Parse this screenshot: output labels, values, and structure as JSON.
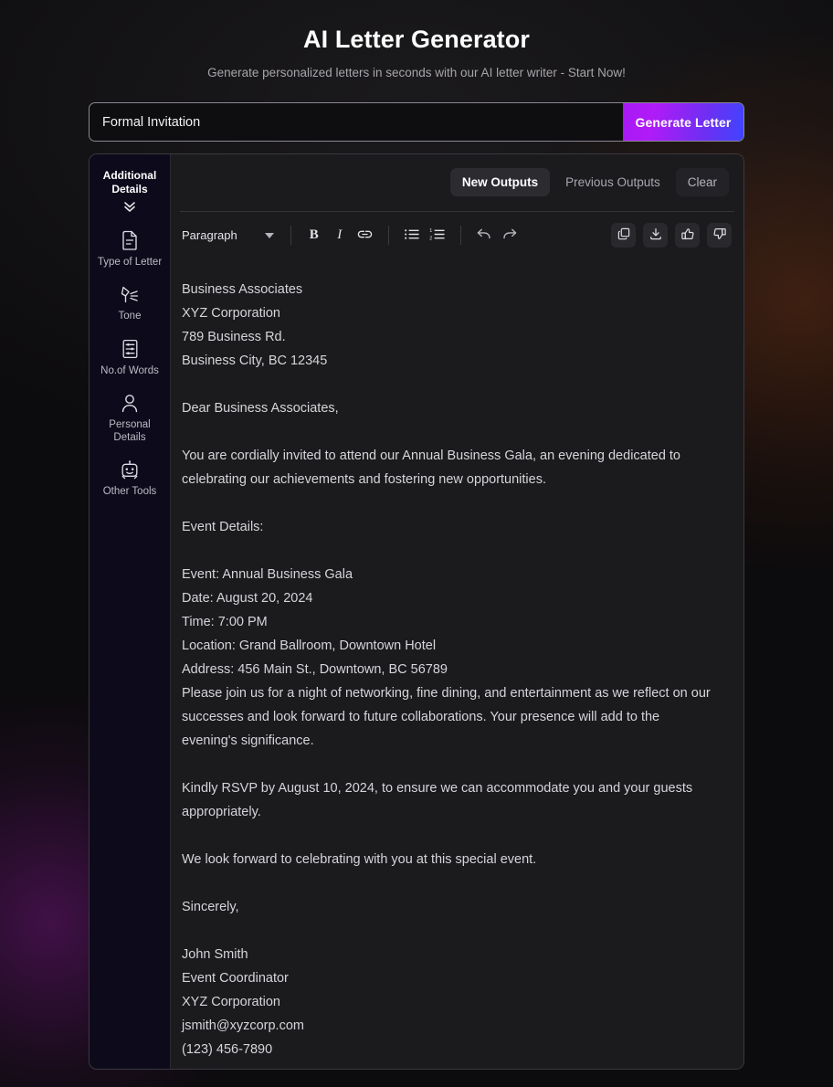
{
  "header": {
    "title": "AI Letter Generator",
    "subtitle": "Generate personalized letters in seconds with our AI letter writer - Start Now!"
  },
  "search": {
    "value": "Formal Invitation",
    "placeholder": "Formal Invitation",
    "button_label": "Generate Letter"
  },
  "sidebar": {
    "header": "Additional Details",
    "collapse_icon": "chevrons-down-icon",
    "items": [
      {
        "label": "Type of Letter",
        "icon": "document-icon"
      },
      {
        "label": "Tone",
        "icon": "desk-lamp-icon"
      },
      {
        "label": "No.of Words",
        "icon": "list-settings-icon"
      },
      {
        "label": "Personal Details",
        "icon": "user-icon"
      },
      {
        "label": "Other Tools",
        "icon": "robot-icon"
      }
    ]
  },
  "tabs": [
    {
      "label": "New Outputs",
      "state": "active"
    },
    {
      "label": "Previous Outputs",
      "state": "inactive"
    },
    {
      "label": "Clear",
      "state": "ghost"
    }
  ],
  "toolbar": {
    "block_format": "Paragraph",
    "buttons": [
      {
        "name": "bold",
        "label": "B"
      },
      {
        "name": "italic",
        "label": "I"
      },
      {
        "name": "link",
        "label": ""
      },
      {
        "name": "bullet-list",
        "label": ""
      },
      {
        "name": "numbered-list",
        "label": ""
      },
      {
        "name": "undo",
        "label": ""
      },
      {
        "name": "redo",
        "label": ""
      }
    ],
    "actions": [
      {
        "name": "copy",
        "label": ""
      },
      {
        "name": "download",
        "label": ""
      },
      {
        "name": "thumbs-up",
        "label": ""
      },
      {
        "name": "thumbs-down",
        "label": ""
      }
    ]
  },
  "letter": {
    "recipient": {
      "name": "Business Associates",
      "company": "XYZ Corporation",
      "street": "789 Business Rd.",
      "city_line": "Business City, BC 12345"
    },
    "salutation": "Dear Business Associates,",
    "intro": "You are cordially invited to attend our Annual Business Gala, an evening dedicated to celebrating our achievements and fostering new opportunities.",
    "details_heading": "Event Details:",
    "details": {
      "event": "Event: Annual Business Gala",
      "date": "Date: August 20, 2024",
      "time": "Time: 7:00 PM",
      "location": "Location: Grand Ballroom, Downtown Hotel",
      "address": "Address: 456 Main St., Downtown, BC 56789",
      "note": "Please join us for a night of networking, fine dining, and entertainment as we reflect on our successes and look forward to future collaborations. Your presence will add to the evening's significance."
    },
    "rsvp": "Kindly RSVP by August 10, 2024, to ensure we can accommodate you and your guests appropriately.",
    "closing_line": "We look forward to celebrating with you at this special event.",
    "sign_off": "Sincerely,",
    "signature": {
      "name": "John Smith",
      "title": "Event Coordinator",
      "company": "XYZ Corporation",
      "email": "jsmith@xyzcorp.com",
      "phone": "(123) 456-7890"
    }
  },
  "colors": {
    "accent_purple": "#a819f5",
    "accent_blue": "#3f45ff",
    "panel_bg": "#1b1a1d",
    "sidebar_bg": "#0d0a1b",
    "page_bg": "#0b0a0c",
    "glow_orange": "#ac4914",
    "glow_purple": "#881896"
  }
}
